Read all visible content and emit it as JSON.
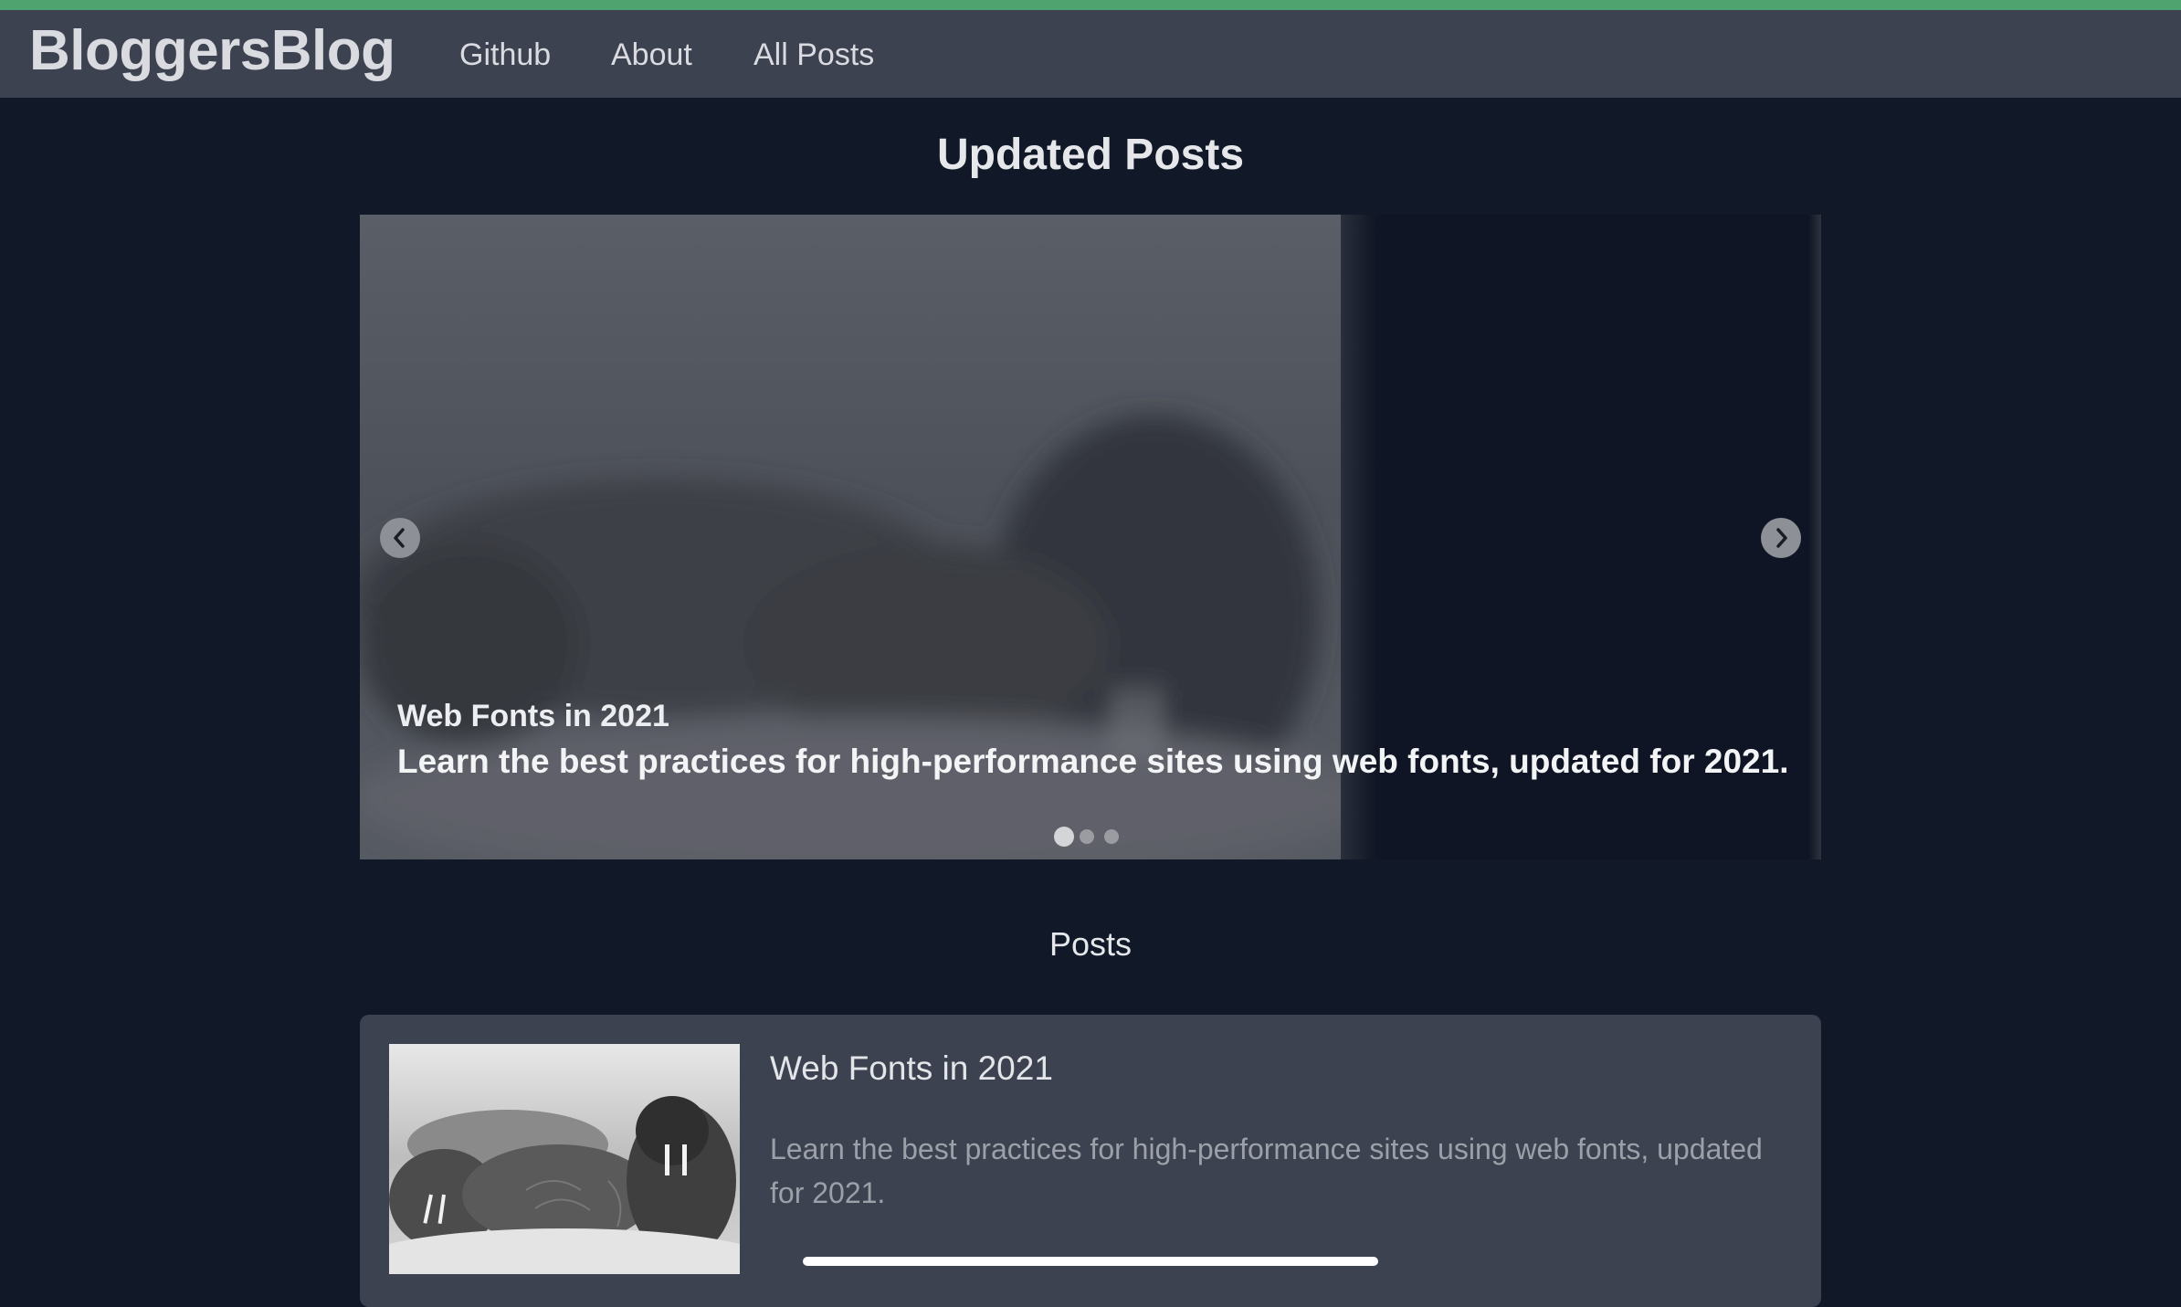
{
  "site": {
    "brand": "BloggersBlog",
    "nav": {
      "github": "Github",
      "about": "About",
      "all_posts": "All Posts"
    },
    "accent_color": "#4fa36e"
  },
  "updated_posts": {
    "heading": "Updated Posts",
    "slides": [
      {
        "title": "Web Fonts in 2021",
        "description": "Learn the best practices for high-performance sites using web fonts, updated for 2021."
      }
    ],
    "slide_count": 3,
    "active_slide": 1,
    "prev_icon": "chevron-left-icon",
    "next_icon": "chevron-right-icon"
  },
  "posts": {
    "heading": "Posts",
    "items": [
      {
        "title": "Web Fonts in 2021",
        "description": "Learn the best practices for high-performance sites using web fonts, updated for 2021.",
        "image": "walrus-photo"
      }
    ]
  }
}
